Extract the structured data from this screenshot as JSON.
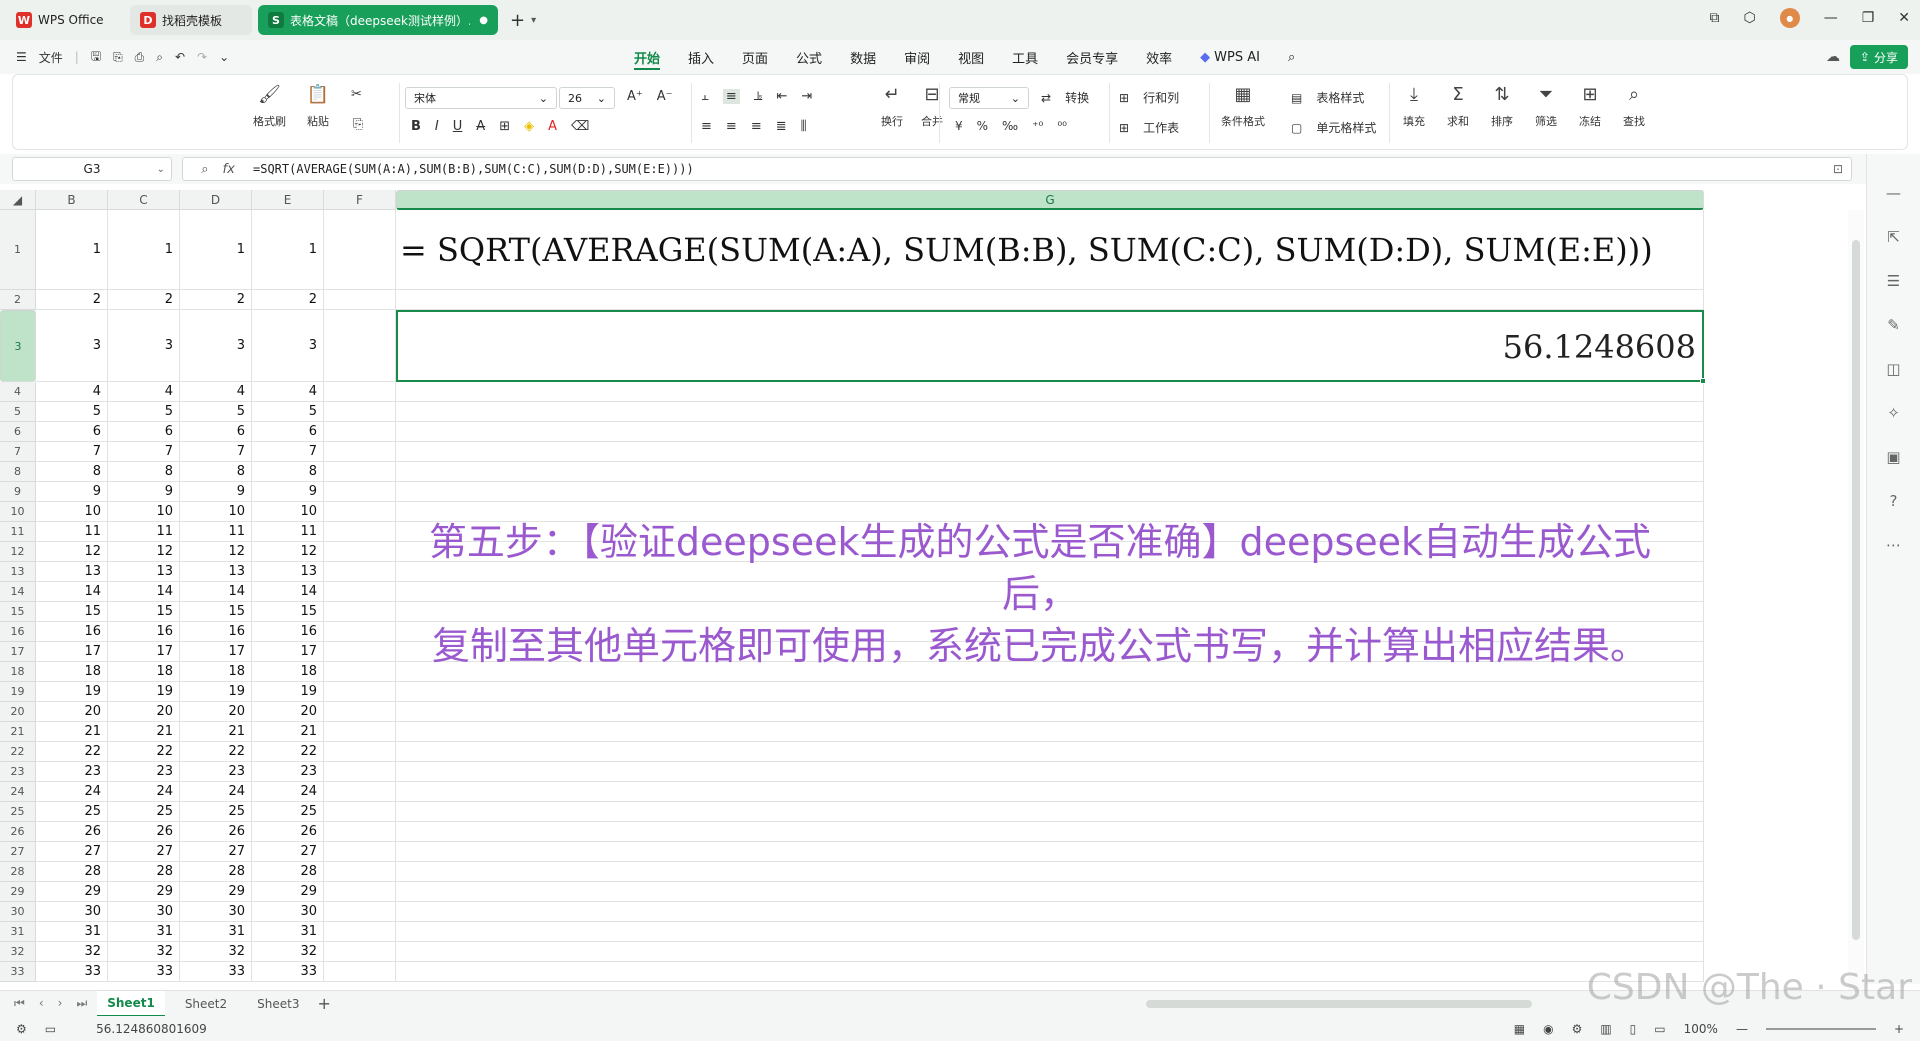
{
  "titlebar": {
    "tabs": [
      {
        "label": "WPS Office"
      },
      {
        "label": "找稻壳模板"
      },
      {
        "label": "表格文稿（deepseek测试样例）..."
      }
    ],
    "new_tab": "+"
  },
  "menubar": {
    "file": "文件",
    "items": [
      "开始",
      "插入",
      "页面",
      "公式",
      "数据",
      "审阅",
      "视图",
      "工具",
      "会员专享",
      "效率"
    ],
    "wps_ai": "WPS AI",
    "share": "分享"
  },
  "ribbon": {
    "format_painter": "格式刷",
    "paste": "粘贴",
    "font_name": "宋体",
    "font_size": "26",
    "wrap": "换行",
    "merge": "合并",
    "number_format": "常规",
    "convert": "转换",
    "row_col": "行和列",
    "worksheet": "工作表",
    "cond_format": "条件格式",
    "table_style": "表格样式",
    "cell_style": "单元格样式",
    "fill": "填充",
    "sum": "求和",
    "sort": "排序",
    "filter": "筛选",
    "freeze": "冻结",
    "find": "查找"
  },
  "formula_bar": {
    "name_box": "G3",
    "formula": "=SQRT(AVERAGE(SUM(A:A),SUM(B:B),SUM(C:C),SUM(D:D),SUM(E:E))))"
  },
  "columns": [
    "B",
    "C",
    "D",
    "E",
    "F",
    "G"
  ],
  "rows": [
    1,
    2,
    3,
    4,
    5,
    6,
    7,
    8,
    9,
    10,
    11,
    12,
    13,
    14,
    15,
    16,
    17,
    18,
    19,
    20,
    21,
    22,
    23,
    24,
    25,
    26,
    27,
    28,
    29,
    30,
    31,
    32,
    33
  ],
  "g1_text": "= SQRT(AVERAGE(SUM(A:A), SUM(B:B), SUM(C:C), SUM(D:D), SUM(E:E)))",
  "g3_value": "56.1248608",
  "overlay_text": {
    "line1": "第五步：【验证deepseek生成的公式是否准确】deepseek自动生成公式后，",
    "line2": "复制至其他单元格即可使用，系统已完成公式书写，并计算出相应结果。"
  },
  "sheets": [
    "Sheet1",
    "Sheet2",
    "Sheet3"
  ],
  "status": {
    "value": "56.124860801609",
    "zoom": "100%"
  },
  "watermark": "CSDN @The · Star"
}
